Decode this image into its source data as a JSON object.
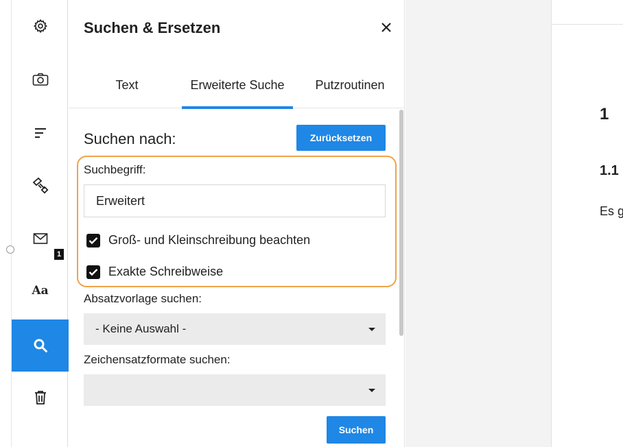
{
  "sidebar": {
    "items": [
      {
        "icon": "gear-icon"
      },
      {
        "icon": "camera-icon"
      },
      {
        "icon": "filter-lines-icon"
      },
      {
        "icon": "paint-brush-icon"
      },
      {
        "icon": "mail-icon"
      },
      {
        "icon": "font-icon",
        "label": "Aa",
        "badge": "1"
      },
      {
        "icon": "search-icon",
        "active": true
      },
      {
        "icon": "trash-icon"
      }
    ],
    "accent": "#1f87e5"
  },
  "panel": {
    "title": "Suchen & Ersetzen",
    "close_label": "✕",
    "tabs": [
      {
        "label": "Text"
      },
      {
        "label": "Erweiterte Suche",
        "active": true
      },
      {
        "label": "Putzroutinen"
      }
    ],
    "search_for_label": "Suchen nach:",
    "reset_button": "Zurücksetzen",
    "term_label": "Suchbegriff:",
    "term_value": "Erweitert",
    "case_sensitive_label": "Groß- und Kleinschreibung beachten",
    "case_sensitive_checked": true,
    "exact_label": "Exakte Schreibweise",
    "exact_checked": true,
    "paragraph_style_label": "Absatzvorlage suchen:",
    "paragraph_style_value": "- Keine Auswahl -",
    "char_format_label": "Zeichensatzformate suchen:",
    "char_format_value": "",
    "search_button": "Suchen",
    "highlight_color": "#f0a24a"
  },
  "document": {
    "heading1": "1",
    "heading2": "1.1",
    "body_start": "Es g"
  }
}
